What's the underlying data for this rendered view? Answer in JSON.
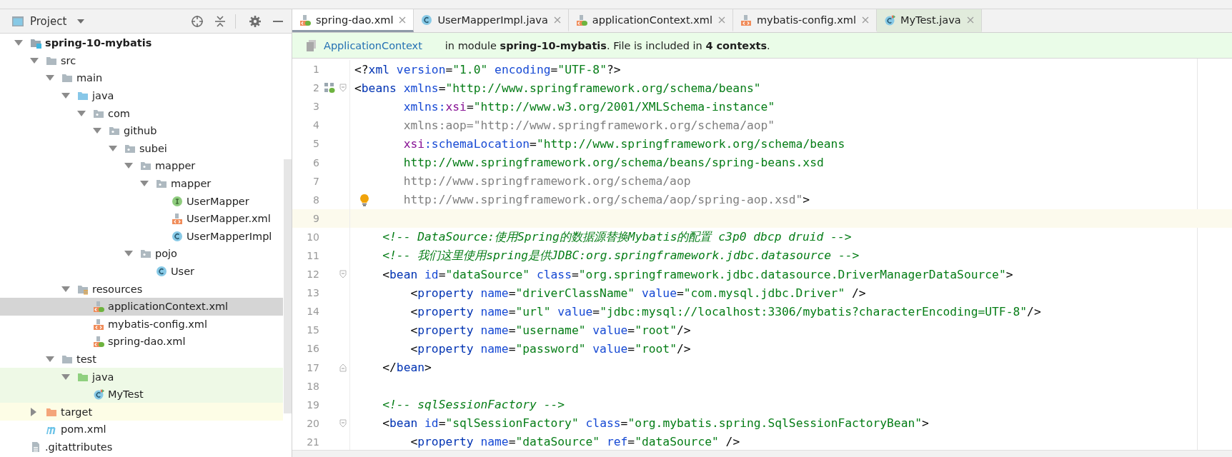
{
  "project_panel": {
    "title": "Project"
  },
  "tree": [
    {
      "label": "spring-10-mybatis",
      "kind": "module",
      "expanded": true,
      "selected": false,
      "children": [
        {
          "label": "src",
          "kind": "folder",
          "expanded": true,
          "selected": false,
          "children": [
            {
              "label": "main",
              "kind": "folder",
              "expanded": true,
              "selected": false,
              "children": [
                {
                  "label": "java",
                  "kind": "source-folder",
                  "expanded": true,
                  "selected": false,
                  "children": [
                    {
                      "label": "com",
                      "kind": "package",
                      "expanded": true,
                      "selected": false,
                      "children": [
                        {
                          "label": "github",
                          "kind": "package",
                          "expanded": true,
                          "selected": false,
                          "children": [
                            {
                              "label": "subei",
                              "kind": "package",
                              "expanded": true,
                              "selected": false,
                              "children": [
                                {
                                  "label": "mapper",
                                  "kind": "package",
                                  "expanded": true,
                                  "selected": false,
                                  "children": [
                                    {
                                      "label": "mapper",
                                      "kind": "package",
                                      "expanded": true,
                                      "selected": false,
                                      "children": [
                                        {
                                          "label": "UserMapper",
                                          "kind": "interface",
                                          "selected": false
                                        },
                                        {
                                          "label": "UserMapper.xml",
                                          "kind": "xml",
                                          "selected": false
                                        },
                                        {
                                          "label": "UserMapperImpl",
                                          "kind": "class",
                                          "selected": false
                                        }
                                      ]
                                    }
                                  ]
                                },
                                {
                                  "label": "pojo",
                                  "kind": "package",
                                  "expanded": true,
                                  "selected": false,
                                  "children": [
                                    {
                                      "label": "User",
                                      "kind": "class",
                                      "selected": false
                                    }
                                  ]
                                }
                              ]
                            }
                          ]
                        }
                      ]
                    }
                  ]
                },
                {
                  "label": "resources",
                  "kind": "resources-folder",
                  "expanded": true,
                  "selected": false,
                  "children": [
                    {
                      "label": "applicationContext.xml",
                      "kind": "spring-xml",
                      "selected": true
                    },
                    {
                      "label": "mybatis-config.xml",
                      "kind": "xml",
                      "selected": false
                    },
                    {
                      "label": "spring-dao.xml",
                      "kind": "spring-xml",
                      "selected": false
                    }
                  ]
                }
              ]
            },
            {
              "label": "test",
              "kind": "folder",
              "expanded": true,
              "selected": false,
              "children": [
                {
                  "label": "java",
                  "kind": "test-folder",
                  "expanded": true,
                  "selected": false,
                  "test_source": true,
                  "children": [
                    {
                      "label": "MyTest",
                      "kind": "test-class",
                      "selected": false,
                      "test_source": true
                    }
                  ]
                }
              ]
            }
          ]
        },
        {
          "label": "target",
          "kind": "excluded-folder",
          "expanded": false,
          "selected": false,
          "excluded": true
        },
        {
          "label": "pom.xml",
          "kind": "maven",
          "selected": false
        }
      ]
    },
    {
      "label": ".gitattributes",
      "kind": "text-file",
      "selected": false
    }
  ],
  "tabs": [
    {
      "label": "spring-dao.xml",
      "kind": "spring-xml",
      "selected": true
    },
    {
      "label": "UserMapperImpl.java",
      "kind": "class",
      "selected": false
    },
    {
      "label": "applicationContext.xml",
      "kind": "spring-xml",
      "selected": false
    },
    {
      "label": "mybatis-config.xml",
      "kind": "xml",
      "selected": false
    },
    {
      "label": "MyTest.java",
      "kind": "test-class",
      "selected": false,
      "test_source": true
    }
  ],
  "context_bar": {
    "link": "ApplicationContext",
    "message": "in module **spring-10-mybatis**. File is included in **4 contexts**."
  },
  "lines": [
    {
      "number": "1",
      "tokens": [
        {
          "kind": "p",
          "text": "<?"
        },
        {
          "kind": "tag",
          "text": "xml"
        },
        {
          "kind": "attr",
          "text": " version"
        },
        {
          "kind": "p",
          "text": "="
        },
        {
          "kind": "str",
          "text": "\"1.0\""
        },
        {
          "kind": "attr",
          "text": " encoding"
        },
        {
          "kind": "p",
          "text": "="
        },
        {
          "kind": "str",
          "text": "\"UTF-8\""
        },
        {
          "kind": "p",
          "text": "?>"
        }
      ]
    },
    {
      "number": "2",
      "bean_marker": true,
      "fold_start": true,
      "tokens": [
        {
          "kind": "p",
          "text": "<"
        },
        {
          "kind": "tag",
          "text": "beans"
        },
        {
          "kind": "attr",
          "text": " xmlns"
        },
        {
          "kind": "p",
          "text": "="
        },
        {
          "kind": "str",
          "text": "\"http://www.springframework.org/schema/beans\""
        }
      ]
    },
    {
      "number": "3",
      "tokens": [
        {
          "kind": "attr",
          "text": "       xmlns:"
        },
        {
          "kind": "ns",
          "text": "xsi"
        },
        {
          "kind": "p",
          "text": "="
        },
        {
          "kind": "str",
          "text": "\"http://www.w3.org/2001/XMLSchema-instance\""
        }
      ]
    },
    {
      "number": "4",
      "tokens": [
        {
          "kind": "dim",
          "text": "       xmlns:aop=\"http://www.springframework.org/schema/aop\""
        }
      ]
    },
    {
      "number": "5",
      "tokens": [
        {
          "kind": "ns",
          "text": "       xsi"
        },
        {
          "kind": "attr",
          "text": ":schemaLocation"
        },
        {
          "kind": "p",
          "text": "="
        },
        {
          "kind": "str",
          "text": "\"http://www.springframework.org/schema/beans"
        }
      ]
    },
    {
      "number": "6",
      "tokens": [
        {
          "kind": "str",
          "text": "       http://www.springframework.org/schema/beans/spring-beans.xsd"
        }
      ]
    },
    {
      "number": "7",
      "tokens": [
        {
          "kind": "dim",
          "text": "       http://www.springframework.org/schema/aop"
        }
      ]
    },
    {
      "number": "8",
      "intention_bulb": true,
      "tokens": [
        {
          "kind": "dim",
          "text": "       http://www.springframework.org/schema/aop/spring-aop.xsd\""
        },
        {
          "kind": "p",
          "text": ">"
        }
      ]
    },
    {
      "number": "9",
      "current": true
    },
    {
      "number": "10",
      "tokens": [
        {
          "kind": "comment",
          "text": "    <!-- DataSource:使用Spring的数据源替换Mybatis的配置 c3p0 dbcp druid -->"
        }
      ]
    },
    {
      "number": "11",
      "tokens": [
        {
          "kind": "comment",
          "text": "    <!-- 我们这里使用spring是供JDBC:org.springframework.jdbc.datasource -->"
        }
      ]
    },
    {
      "number": "12",
      "fold_start": true,
      "tokens": [
        {
          "kind": "p",
          "text": "    <"
        },
        {
          "kind": "tag",
          "text": "bean"
        },
        {
          "kind": "attr",
          "text": " id"
        },
        {
          "kind": "p",
          "text": "="
        },
        {
          "kind": "str",
          "text": "\"dataSource\""
        },
        {
          "kind": "attr",
          "text": " class"
        },
        {
          "kind": "p",
          "text": "="
        },
        {
          "kind": "str",
          "text": "\"org.springframework.jdbc.datasource.DriverManagerDataSource\""
        },
        {
          "kind": "p",
          "text": ">"
        }
      ]
    },
    {
      "number": "13",
      "tokens": [
        {
          "kind": "p",
          "text": "        <"
        },
        {
          "kind": "tag",
          "text": "property"
        },
        {
          "kind": "attr",
          "text": " name"
        },
        {
          "kind": "p",
          "text": "="
        },
        {
          "kind": "str",
          "text": "\"driverClassName\""
        },
        {
          "kind": "attr",
          "text": " value"
        },
        {
          "kind": "p",
          "text": "="
        },
        {
          "kind": "str",
          "text": "\"com.mysql.jdbc.Driver\""
        },
        {
          "kind": "p",
          "text": " />"
        }
      ]
    },
    {
      "number": "14",
      "tokens": [
        {
          "kind": "p",
          "text": "        <"
        },
        {
          "kind": "tag",
          "text": "property"
        },
        {
          "kind": "attr",
          "text": " name"
        },
        {
          "kind": "p",
          "text": "="
        },
        {
          "kind": "str",
          "text": "\"url\""
        },
        {
          "kind": "attr",
          "text": " value"
        },
        {
          "kind": "p",
          "text": "="
        },
        {
          "kind": "str",
          "text": "\"jdbc:mysql://localhost:3306/mybatis?characterEncoding=UTF-8\""
        },
        {
          "kind": "p",
          "text": "/>"
        }
      ]
    },
    {
      "number": "15",
      "tokens": [
        {
          "kind": "p",
          "text": "        <"
        },
        {
          "kind": "tag",
          "text": "property"
        },
        {
          "kind": "attr",
          "text": " name"
        },
        {
          "kind": "p",
          "text": "="
        },
        {
          "kind": "str",
          "text": "\"username\""
        },
        {
          "kind": "attr",
          "text": " value"
        },
        {
          "kind": "p",
          "text": "="
        },
        {
          "kind": "str",
          "text": "\"root\""
        },
        {
          "kind": "p",
          "text": "/>"
        }
      ]
    },
    {
      "number": "16",
      "tokens": [
        {
          "kind": "p",
          "text": "        <"
        },
        {
          "kind": "tag",
          "text": "property"
        },
        {
          "kind": "attr",
          "text": " name"
        },
        {
          "kind": "p",
          "text": "="
        },
        {
          "kind": "str",
          "text": "\"password\""
        },
        {
          "kind": "attr",
          "text": " value"
        },
        {
          "kind": "p",
          "text": "="
        },
        {
          "kind": "str",
          "text": "\"root\""
        },
        {
          "kind": "p",
          "text": "/>"
        }
      ]
    },
    {
      "number": "17",
      "fold_end": true,
      "tokens": [
        {
          "kind": "p",
          "text": "    </"
        },
        {
          "kind": "tag",
          "text": "bean"
        },
        {
          "kind": "p",
          "text": ">"
        }
      ]
    },
    {
      "number": "18"
    },
    {
      "number": "19",
      "tokens": [
        {
          "kind": "comment",
          "text": "    <!-- sqlSessionFactory -->"
        }
      ]
    },
    {
      "number": "20",
      "fold_start": true,
      "tokens": [
        {
          "kind": "p",
          "text": "    <"
        },
        {
          "kind": "tag",
          "text": "bean"
        },
        {
          "kind": "attr",
          "text": " id"
        },
        {
          "kind": "p",
          "text": "="
        },
        {
          "kind": "str",
          "text": "\"sqlSessionFactory\""
        },
        {
          "kind": "attr",
          "text": " class"
        },
        {
          "kind": "p",
          "text": "="
        },
        {
          "kind": "str",
          "text": "\"org.mybatis.spring.SqlSessionFactoryBean\""
        },
        {
          "kind": "p",
          "text": ">"
        }
      ]
    },
    {
      "number": "21",
      "tokens": [
        {
          "kind": "p",
          "text": "        <"
        },
        {
          "kind": "tag",
          "text": "property"
        },
        {
          "kind": "attr",
          "text": " name"
        },
        {
          "kind": "p",
          "text": "="
        },
        {
          "kind": "str",
          "text": "\"dataSource\""
        },
        {
          "kind": "attr",
          "text": " ref"
        },
        {
          "kind": "p",
          "text": "="
        },
        {
          "kind": "str",
          "text": "\"dataSource\""
        },
        {
          "kind": "p",
          "text": " />"
        }
      ]
    }
  ]
}
